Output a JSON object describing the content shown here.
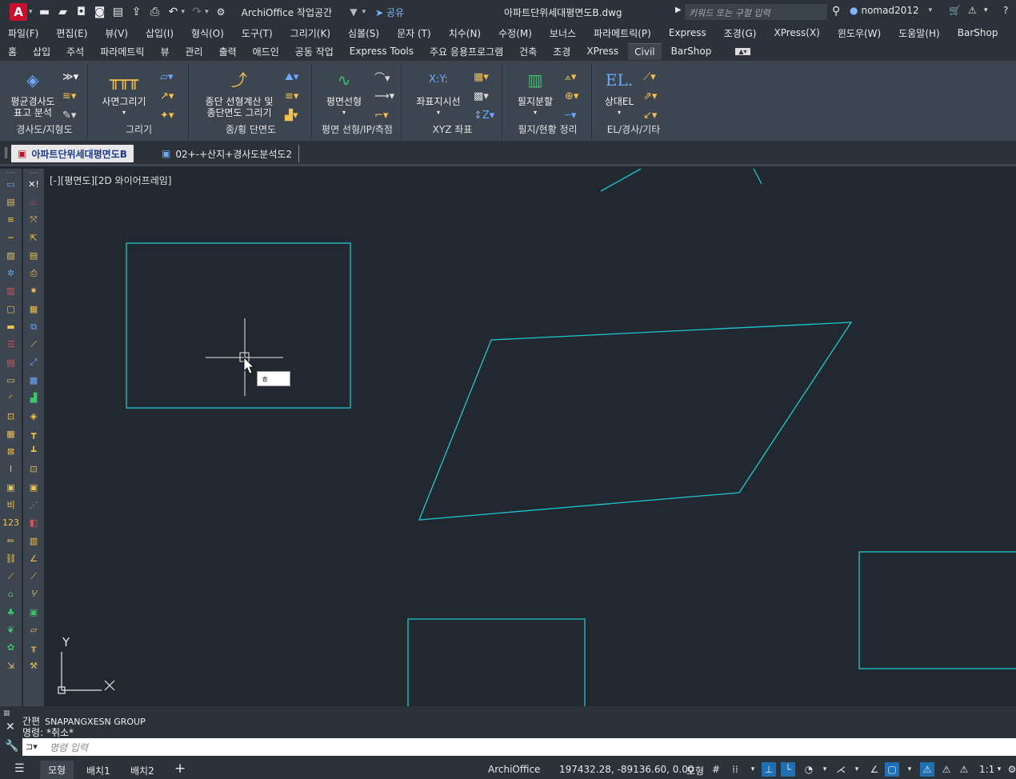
{
  "titlebar": {
    "app_letter": "A",
    "workspace": "ArchiOffice 작업공간",
    "share": "공유",
    "filename": "아파트단위세대평면도B.dwg",
    "search_placeholder": "키워드 또는 구절 입력",
    "user": "nomad2012"
  },
  "menu": [
    "파일(F)",
    "편집(E)",
    "뷰(V)",
    "삽입(I)",
    "형식(O)",
    "도구(T)",
    "그리기(K)",
    "심볼(S)",
    "문자 (T)",
    "치수(N)",
    "수정(M)",
    "보너스",
    "파라메트릭(P)",
    "Express",
    "조경(G)",
    "XPress(X)",
    "윈도우(W)",
    "도움말(H)",
    "BarShop"
  ],
  "ribbon_tabs": [
    "홈",
    "삽입",
    "주석",
    "파라메트릭",
    "뷰",
    "관리",
    "출력",
    "애드인",
    "공동 작업",
    "Express Tools",
    "주요 응용프로그램",
    "건축",
    "조경",
    "XPress",
    "Civil",
    "BarShop"
  ],
  "ribbon_active": "Civil",
  "ribbon": {
    "panels": [
      {
        "title": "경사도/지형도",
        "big": "평균경사도\n표고 분석"
      },
      {
        "title": "그리기",
        "big": "사면그리기"
      },
      {
        "title": "종/횡 단면도",
        "big": "종단 선형계산 및\n종단면도 그리기"
      },
      {
        "title": "평면 선형/IP/측점",
        "big": "평면선형"
      },
      {
        "title": "XYZ 좌표",
        "big": "좌표지시선"
      },
      {
        "title": "필지/현황 정리",
        "big": "필지분할"
      },
      {
        "title": "EL/경사/기타",
        "big": "상대EL"
      }
    ]
  },
  "doc_tabs": [
    "아파트단위세대평면도B",
    "02+-+산지+경사도분석도2"
  ],
  "viewport_label": "[-][평면도][2D 와이어프레임]",
  "cursor_input": "ㅎ",
  "ucs": {
    "x": "X",
    "y": "Y"
  },
  "command": {
    "line1_prefix": "간편",
    "line1": "SNAPANGXESN GROUP",
    "line2": "명령: *취소*",
    "placeholder": "명령 입력"
  },
  "status": {
    "tabs": [
      "모형",
      "배치1",
      "배치2"
    ],
    "app": "ArchiOffice",
    "coords": "197432.28, -89136.60, 0.00",
    "mode": "모형",
    "scale": "1:1"
  },
  "colors": {
    "geometry": "#1fc8d0",
    "canvas": "#212830",
    "ribbon": "#3c4550"
  }
}
